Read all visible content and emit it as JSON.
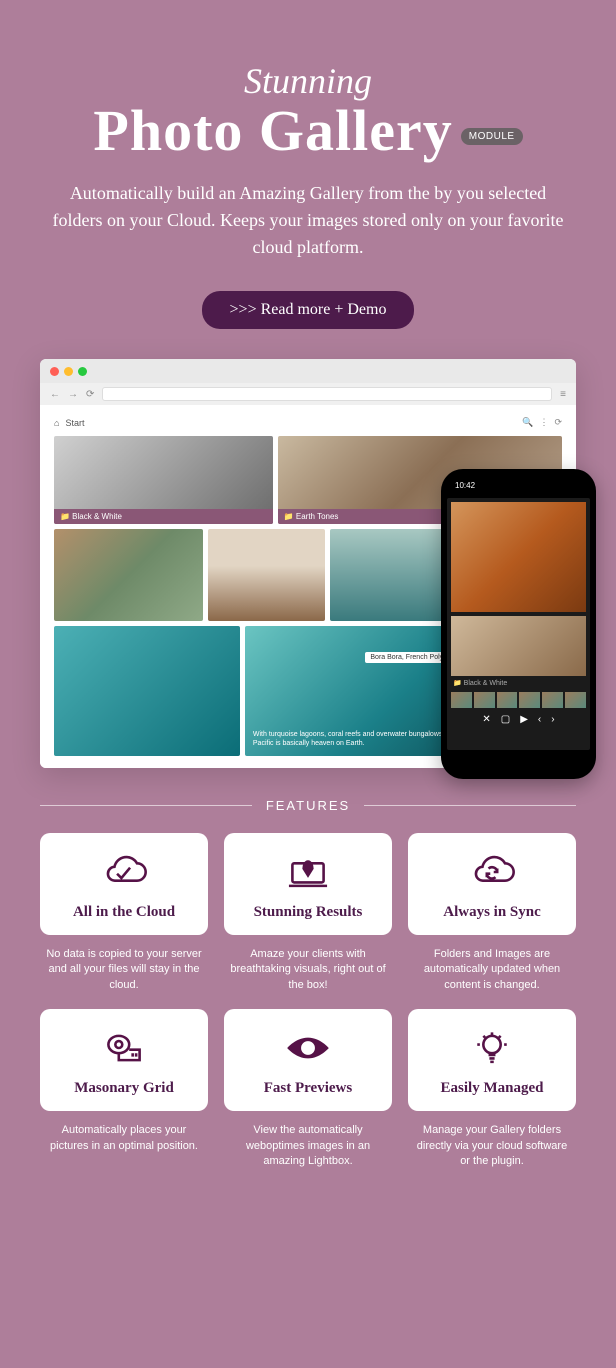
{
  "hero": {
    "eyebrow": "Stunning",
    "title": "Photo Gallery",
    "badge": "MODULE",
    "description": "Automatically build an Amazing Gallery from the by you selected folders on your Cloud. Keeps your images stored only on your favorite cloud platform.",
    "read_more": ">>> Read more + Demo"
  },
  "browser": {
    "breadcrumb_home": "⌂",
    "breadcrumb_start": "Start",
    "toolbar_icons": [
      "search",
      "more",
      "refresh"
    ]
  },
  "gallery": {
    "album_bw": "📁 Black & White",
    "album_earth": "📁 Earth Tones",
    "tooltip": "Bora Bora, French Polynesia",
    "caption": "With turquoise lagoons, coral reefs and overwater bungalows, this small island in the South Pacific is basically heaven on Earth."
  },
  "phone": {
    "time": "10:42",
    "label": "📁 Black & White",
    "controls": [
      "✕",
      "▢",
      "▶",
      "‹",
      "›"
    ]
  },
  "features_label": "FEATURES",
  "features": [
    {
      "title": "All in the Cloud",
      "desc": "No data is copied to your server and all your files will stay in the cloud."
    },
    {
      "title": "Stunning Results",
      "desc": "Amaze your clients with breathtaking visuals, right out of the box!"
    },
    {
      "title": "Always in Sync",
      "desc": "Folders and Images are automatically updated when content is changed."
    },
    {
      "title": "Masonary Grid",
      "desc": "Automatically places your pictures in an optimal position."
    },
    {
      "title": "Fast Previews",
      "desc": "View the automatically weboptimes images in an amazing Lightbox."
    },
    {
      "title": "Easily Managed",
      "desc": "Manage your Gallery folders directly via your cloud software or the plugin."
    }
  ]
}
